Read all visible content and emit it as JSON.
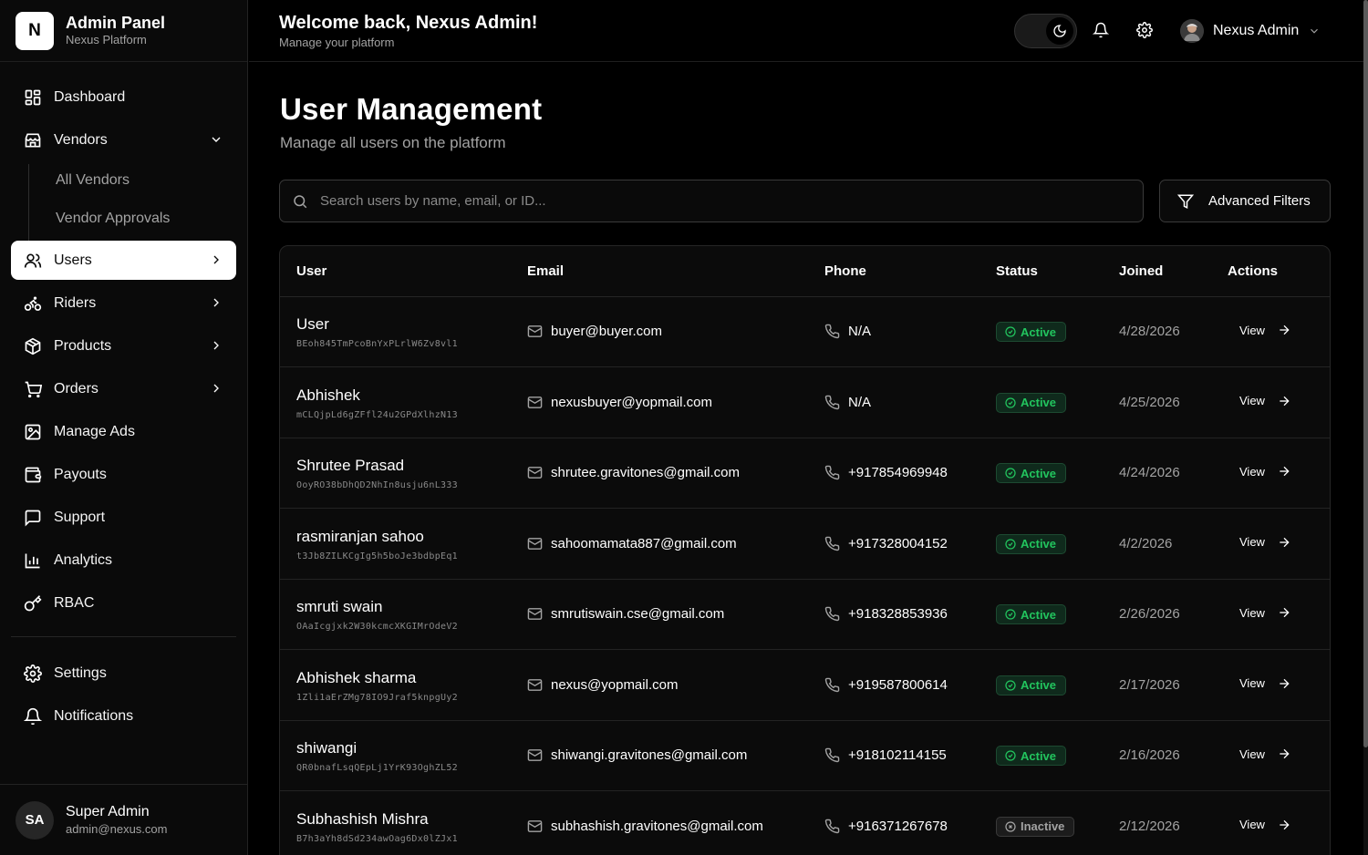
{
  "brand": {
    "logo": "N",
    "title": "Admin Panel",
    "subtitle": "Nexus Platform"
  },
  "nav": {
    "dashboard": "Dashboard",
    "vendors": "Vendors",
    "vendors_sub": [
      "All Vendors",
      "Vendor Approvals"
    ],
    "users": "Users",
    "riders": "Riders",
    "products": "Products",
    "orders": "Orders",
    "manage_ads": "Manage Ads",
    "payouts": "Payouts",
    "support": "Support",
    "analytics": "Analytics",
    "rbac": "RBAC",
    "settings": "Settings",
    "notifications": "Notifications"
  },
  "profile": {
    "initials": "SA",
    "name": "Super Admin",
    "email": "admin@nexus.com"
  },
  "header": {
    "title": "Welcome back, Nexus Admin!",
    "subtitle": "Manage your platform",
    "user_name": "Nexus Admin"
  },
  "main": {
    "title": "User Management",
    "subtitle": "Manage all users on the platform",
    "search_placeholder": "Search users by name, email, or ID...",
    "filters_label": "Advanced Filters"
  },
  "table": {
    "columns": {
      "user": "User",
      "email": "Email",
      "phone": "Phone",
      "status": "Status",
      "joined": "Joined",
      "actions": "Actions"
    },
    "view_label": "View",
    "rows": [
      {
        "name": "User",
        "id": "BEoh845TmPcoBnYxPLrlW6Zv8vl1",
        "email": "buyer@buyer.com",
        "phone": "N/A",
        "status": "Active",
        "joined": "4/28/2026"
      },
      {
        "name": "Abhishek",
        "id": "mCLQjpLd6gZFfl24u2GPdXlhzN13",
        "email": "nexusbuyer@yopmail.com",
        "phone": "N/A",
        "status": "Active",
        "joined": "4/25/2026"
      },
      {
        "name": "Shrutee Prasad",
        "id": "OoyRO38bDhQD2NhIn8usju6nL333",
        "email": "shrutee.gravitones@gmail.com",
        "phone": "+917854969948",
        "status": "Active",
        "joined": "4/24/2026"
      },
      {
        "name": "rasmiranjan sahoo",
        "id": "t3Jb8ZILKCgIg5h5boJe3bdbpEq1",
        "email": "sahoomamata887@gmail.com",
        "phone": "+917328004152",
        "status": "Active",
        "joined": "4/2/2026"
      },
      {
        "name": "smruti swain",
        "id": "OAaIcgjxk2W30kcmcXKGIMrOdeV2",
        "email": "smrutiswain.cse@gmail.com",
        "phone": "+918328853936",
        "status": "Active",
        "joined": "2/26/2026"
      },
      {
        "name": "Abhishek sharma",
        "id": "1Zli1aErZMg78IO9Jraf5knpgUy2",
        "email": "nexus@yopmail.com",
        "phone": "+919587800614",
        "status": "Active",
        "joined": "2/17/2026"
      },
      {
        "name": "shiwangi",
        "id": "QR0bnafLsqQEpLj1YrK93OghZL52",
        "email": "shiwangi.gravitones@gmail.com",
        "phone": "+918102114155",
        "status": "Active",
        "joined": "2/16/2026"
      },
      {
        "name": "Subhashish Mishra",
        "id": "B7h3aYh8dSd234awOag6Dx0lZJx1",
        "email": "subhashish.gravitones@gmail.com",
        "phone": "+916371267678",
        "status": "Inactive",
        "joined": "2/12/2026"
      }
    ]
  },
  "colors": {
    "active_text": "#22c55e",
    "active_bg": "#0f2a1c",
    "inactive_text": "#a3a3a3",
    "surface": "#0a0a0a"
  }
}
